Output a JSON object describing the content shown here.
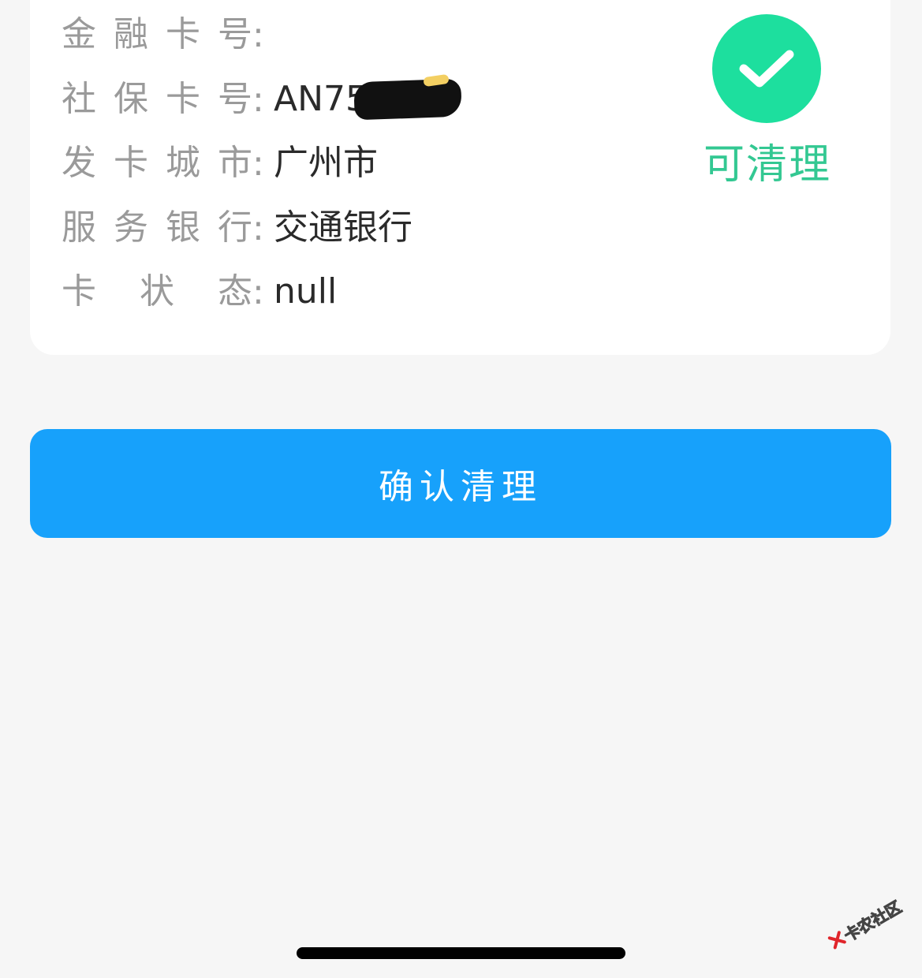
{
  "card_info": {
    "rows": [
      {
        "label_chars": [
          "金",
          "融",
          "卡",
          "号"
        ],
        "colon": ":",
        "value": ""
      },
      {
        "label_chars": [
          "社",
          "保",
          "卡",
          "号"
        ],
        "colon": ":",
        "value": "AN7540"
      },
      {
        "label_chars": [
          "发",
          "卡",
          "城",
          "市"
        ],
        "colon": ":",
        "value": "广州市"
      },
      {
        "label_chars": [
          "服",
          "务",
          "银",
          "行"
        ],
        "colon": ":",
        "value": "交通银行"
      },
      {
        "label_chars": [
          "卡",
          "状",
          "态"
        ],
        "colon": ":",
        "value": "null"
      }
    ]
  },
  "status": {
    "icon": "check-icon",
    "label": "可清理",
    "color": "#33c892",
    "circle_color": "#1ddf9e"
  },
  "actions": {
    "confirm_label": "确认清理",
    "button_color": "#17a1fb"
  },
  "watermark": {
    "text": "卡农社区"
  }
}
